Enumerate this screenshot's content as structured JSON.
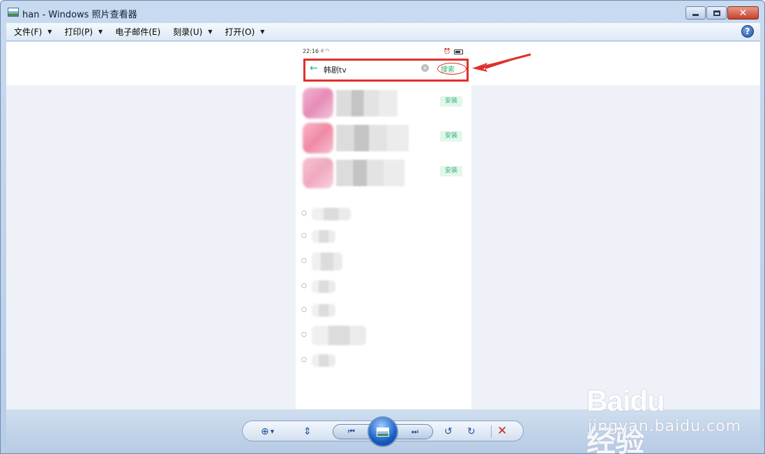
{
  "window": {
    "title": "han - Windows 照片查看器",
    "minimize_icon": "minimize-icon",
    "maximize_icon": "maximize-icon",
    "close_icon": "close-icon",
    "close_glyph": "✕"
  },
  "menu": {
    "items": [
      {
        "label": "文件(F)",
        "has_dropdown": true
      },
      {
        "label": "打印(P)",
        "has_dropdown": true
      },
      {
        "label": "电子邮件(E)",
        "has_dropdown": false
      },
      {
        "label": "刻录(U)",
        "has_dropdown": true
      },
      {
        "label": "打开(O)",
        "has_dropdown": true
      }
    ],
    "dropdown_glyph": "▼",
    "help_glyph": "?"
  },
  "phone": {
    "status_time": "22:16",
    "search_query": "韩剧tv",
    "search_button": "搜索",
    "back_glyph": "←",
    "clear_glyph": "×",
    "install_label": "安装",
    "history_glyph": "○",
    "accent_color": "#2fb36f",
    "highlight_color": "#e0302a"
  },
  "controls": {
    "zoom_glyph": "⊕",
    "zoom_arrow": "▼",
    "fit_glyph": "⇕",
    "prev_glyph": "⏮",
    "next_glyph": "⏭",
    "rotate_ccw_glyph": "↺",
    "rotate_cw_glyph": "↻",
    "delete_glyph": "✕"
  },
  "watermark": {
    "logo": "Baidu经验",
    "url": "jingyan.baidu.com"
  }
}
